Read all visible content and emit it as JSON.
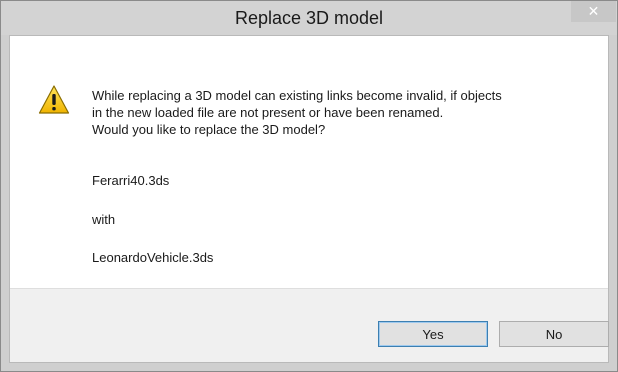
{
  "window": {
    "title": "Replace 3D model",
    "close_glyph": "✕"
  },
  "message": {
    "lines": [
      "While replacing a 3D model can existing links become invalid, if objects",
      "in the new loaded file are not present or have been renamed.",
      "Would you like to replace the 3D model?"
    ]
  },
  "files": {
    "old": "Ferarri40.3ds",
    "connector": "with",
    "new": "LeonardoVehicle.3ds"
  },
  "buttons": {
    "yes": "Yes",
    "no": "No"
  },
  "icon": {
    "name": "warning-icon",
    "fill": "#f2c200",
    "stroke": "#8a6d00",
    "mark": "#1a1a1a"
  }
}
